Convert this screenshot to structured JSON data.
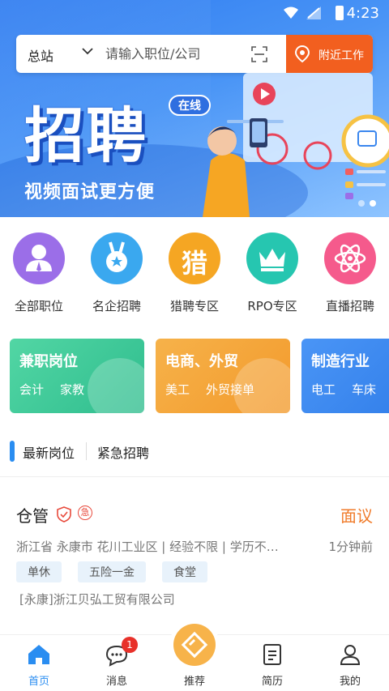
{
  "status_bar": {
    "time": "4:23"
  },
  "search": {
    "city": "总站",
    "placeholder": "请输入职位/公司",
    "nearby_label": "附近工作"
  },
  "banner": {
    "headline": "招聘",
    "tag": "在线",
    "subtitle": "视频面试更方便"
  },
  "categories": [
    {
      "label": "全部职位",
      "icon": "person-icon",
      "color": "#9b6ee8"
    },
    {
      "label": "名企招聘",
      "icon": "medal-icon",
      "color": "#3aa8ef"
    },
    {
      "label": "猎聘专区",
      "icon": "hunt-icon",
      "glyph": "猎",
      "color": "#f5a623"
    },
    {
      "label": "RPO专区",
      "icon": "crown-icon",
      "color": "#26c6b0"
    },
    {
      "label": "直播招聘",
      "icon": "atom-icon",
      "color": "#f55a8c"
    }
  ],
  "cards": [
    {
      "title": "兼职岗位",
      "sub1": "会计",
      "sub2": "家教",
      "color": "#3ec99a"
    },
    {
      "title": "电商、外贸",
      "sub1": "美工",
      "sub2": "外贸接单",
      "color": "#f6a63a"
    },
    {
      "title": "制造行业",
      "sub1": "电工",
      "sub2": "车床",
      "color": "#3a86ee"
    }
  ],
  "tabs": {
    "latest": "最新岗位",
    "urgent": "紧急招聘"
  },
  "job": {
    "title": "仓管",
    "urgent_mark": "急",
    "salary": "面议",
    "meta": "浙江省 永康市 花川工业区 | 经验不限 | 学历不…",
    "time": "1分钟前",
    "tags": [
      "单休",
      "五险一金",
      "食堂"
    ],
    "company": "[永康]浙江贝弘工贸有限公司"
  },
  "nav": {
    "home": "首页",
    "messages": "消息",
    "messages_badge": "1",
    "recommend": "推荐",
    "resume": "简历",
    "mine": "我的"
  },
  "colors": {
    "accent": "#2a8df1",
    "orange": "#f25f1f",
    "salary": "#f07b2a"
  }
}
